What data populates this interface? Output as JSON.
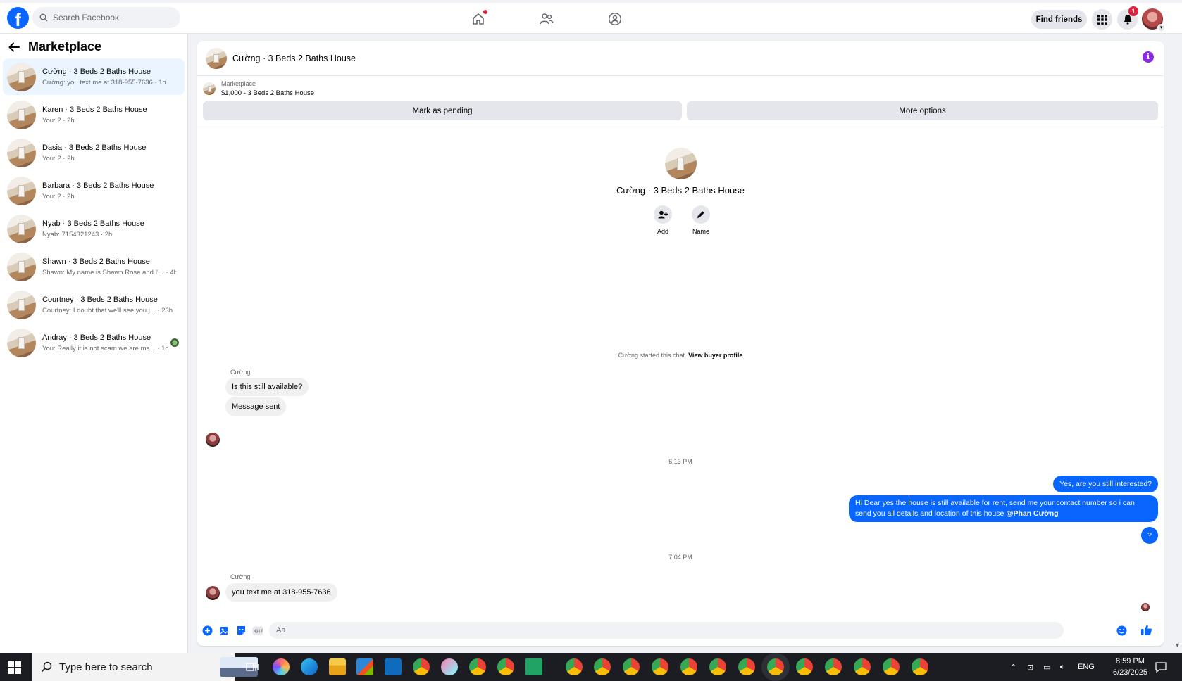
{
  "topbar": {
    "logo_letter": "f",
    "search_placeholder": "Search Facebook",
    "find_friends": "Find friends",
    "notification_count": "1"
  },
  "sidebar": {
    "title": "Marketplace",
    "conversations": [
      {
        "name": "Cường · 3 Beds 2 Baths House",
        "preview": "Cường: you text me at 318-955-7636 · 1h",
        "active": true
      },
      {
        "name": "Karen · 3 Beds 2 Baths House",
        "preview": "You: ? · 2h"
      },
      {
        "name": "Dasia · 3 Beds 2 Baths House",
        "preview": "You: ? · 2h"
      },
      {
        "name": "Barbara · 3 Beds 2 Baths House",
        "preview": "You: ? · 2h"
      },
      {
        "name": "Nyab · 3 Beds 2 Baths House",
        "preview": "Nyab: 7154321243 · 2h"
      },
      {
        "name": "Shawn · 3 Beds 2 Baths House",
        "preview": "Shawn: My name is Shawn Rose and I'... · 4h"
      },
      {
        "name": "Courtney · 3 Beds 2 Baths House",
        "preview": "Courtney: I doubt that we'll see you j... · 23h"
      },
      {
        "name": "Andray · 3 Beds 2 Baths House",
        "preview": "You: Really it is not scam we are ma... · 1d"
      }
    ]
  },
  "chat": {
    "title": "Cường · 3 Beds 2 Baths House",
    "listing_source": "Marketplace",
    "listing_price_title": "$1,000 - 3 Beds 2 Baths House",
    "mark_pending": "Mark as pending",
    "more_options": "More options",
    "profile_name": "Cường · 3 Beds 2 Baths House",
    "add_label": "Add",
    "name_label": "Name",
    "started_text": "Cường started this chat.",
    "view_buyer_profile": "View buyer profile",
    "sender_1": "Cường",
    "msg_in_1": "Is this still available?",
    "msg_in_2": "Message sent",
    "time_1": "6:13 PM",
    "msg_out_1": "Yes, are you still interested?",
    "msg_out_2": "Hi Dear yes the house is still available for rent, send me your contact number so i can send you all details and location of this house",
    "msg_out_2_mention": "@Phan Cường",
    "msg_out_3": "?",
    "time_2": "7:04 PM",
    "sender_2": "Cường",
    "msg_in_3": "you text me at 318-955-7636",
    "composer_placeholder": "Aa"
  },
  "taskbar": {
    "search_placeholder": "Type here to search",
    "language": "ENG",
    "time": "8:59 PM",
    "date": "6/23/2025"
  },
  "colors": {
    "brand_blue": "#0866ff",
    "active_conv_bg": "#ebf5ff",
    "badge_red": "#e41e3f",
    "info_purple": "#8a2be2"
  }
}
